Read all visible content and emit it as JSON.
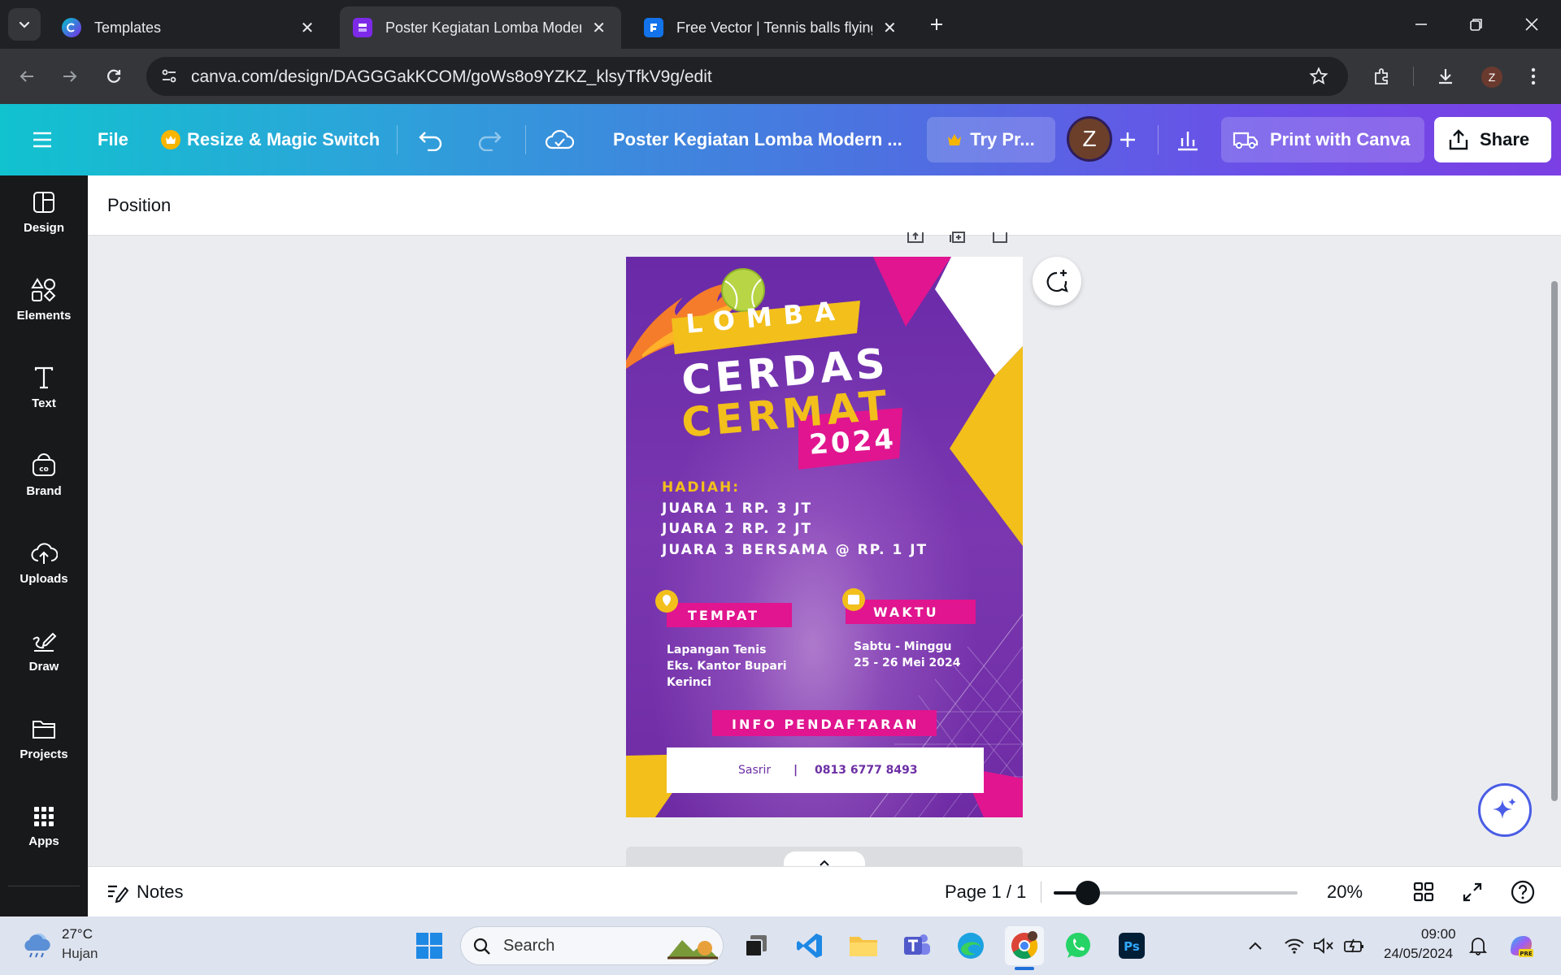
{
  "browser": {
    "tabs": [
      {
        "title": "Templates",
        "active": false
      },
      {
        "title": "Poster Kegiatan Lomba Modern",
        "active": true
      },
      {
        "title": "Free Vector | Tennis balls flying",
        "active": false
      }
    ],
    "url": "canva.com/design/DAGGGakKCOM/goWs8o9YZKZ_klsyTfkV9g/edit",
    "profile_initial": "Z"
  },
  "canva_header": {
    "file_label": "File",
    "resize_label": "Resize & Magic Switch",
    "design_title": "Poster Kegiatan Lomba Modern ...",
    "try_pro_label": "Try Pr...",
    "avatar_initial": "Z",
    "print_label": "Print with Canva",
    "share_label": "Share"
  },
  "sidebar": {
    "items": [
      {
        "label": "Design",
        "icon": "design-icon"
      },
      {
        "label": "Elements",
        "icon": "elements-icon"
      },
      {
        "label": "Text",
        "icon": "text-icon"
      },
      {
        "label": "Brand",
        "icon": "brand-icon"
      },
      {
        "label": "Uploads",
        "icon": "uploads-icon"
      },
      {
        "label": "Draw",
        "icon": "draw-icon"
      },
      {
        "label": "Projects",
        "icon": "projects-icon"
      },
      {
        "label": "Apps",
        "icon": "apps-icon"
      }
    ]
  },
  "context_bar": {
    "position_label": "Position"
  },
  "poster": {
    "lomba": "LOMBA",
    "cerdas": "CERDAS",
    "cermat": "CERMAT",
    "year": "2024",
    "hadiah_title": "HADIAH:",
    "prizes": [
      "JUARA 1 RP. 3 JT",
      "JUARA 2 RP. 2 JT",
      "JUARA 3 BERSAMA @ RP. 1 JT"
    ],
    "tempat_label": "TEMPAT",
    "tempat_lines": [
      "Lapangan Tenis",
      "Eks. Kantor Bupari",
      "Kerinci"
    ],
    "waktu_label": "WAKTU",
    "waktu_lines": [
      "Sabtu - Minggu",
      "25 - 26 Mei 2024"
    ],
    "info_label": "INFO PENDAFTARAN",
    "contact_name": "Sasrir",
    "contact_separator": "|",
    "contact_phone": "0813 6777 8493",
    "colors": {
      "purple": "#6d2fa5",
      "magenta": "#e0158f",
      "yellow": "#f2bf1b",
      "white": "#ffffff"
    }
  },
  "footer": {
    "notes_label": "Notes",
    "page_label": "Page 1 / 1",
    "zoom_label": "20%",
    "zoom_level": 0.14
  },
  "taskbar": {
    "weather_temp": "27°C",
    "weather_desc": "Hujan",
    "search_placeholder": "Search",
    "time": "09:00",
    "date": "24/05/2024"
  }
}
